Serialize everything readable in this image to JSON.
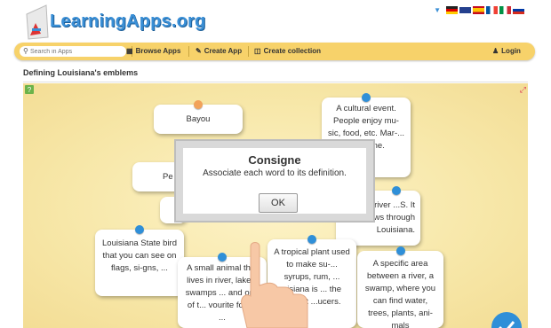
{
  "header": {
    "logo_text": "LearningApps.org",
    "flags": [
      "German",
      "English",
      "Spanish",
      "French",
      "Italian",
      "Russian"
    ]
  },
  "navbar": {
    "search_placeholder": "Search in Apps",
    "browse": "Browse Apps",
    "create_app": "Create App",
    "create_collection": "Create collection",
    "login": "Login"
  },
  "page": {
    "title": "Defining Louisiana's emblems"
  },
  "cards": {
    "bayou": "Bayou",
    "pe_partial": "Pe",
    "cultural_event": "A cultural event. People enjoy mu-sic, food, etc. Mar-... very ...ne.",
    "river_partial": "...gest river ...S. It flows through Louisiana.",
    "bird": "Louisiana State bird that you can see on flags, si-gns, ...",
    "small_animal": "A small animal that lives in river, lakes, swamps ... and one of t... vourite foods ...",
    "tropical_plant": "A tropical plant used to make su-... syrups, rum, ... uisiana is ... the largest ...ucers.",
    "specific_area": "A specific area between a river, a swamp, where you can find water, trees, plants, ani-mals"
  },
  "dialog": {
    "title": "Consigne",
    "message": "Associate each word to its definition.",
    "ok": "OK"
  }
}
